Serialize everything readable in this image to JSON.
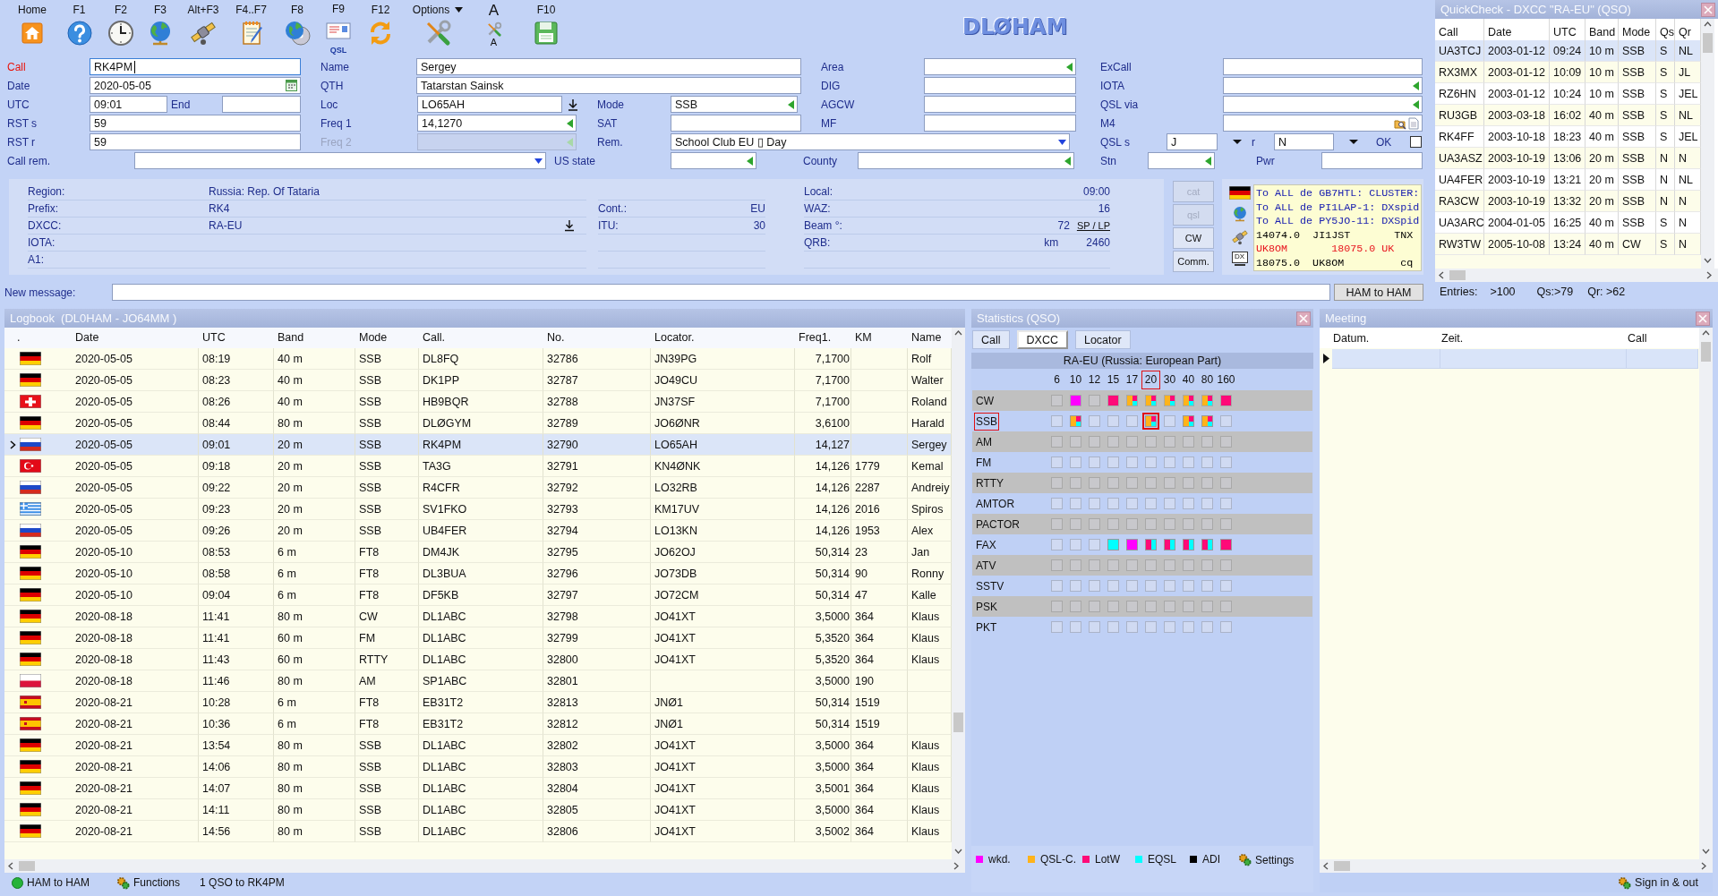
{
  "toolbar": {
    "buttons": [
      {
        "label": "Home"
      },
      {
        "label": "F1"
      },
      {
        "label": "F2"
      },
      {
        "label": "F3"
      },
      {
        "label": "Alt+F3"
      },
      {
        "label": "F4..F7"
      },
      {
        "label": "F8"
      },
      {
        "label": "F9",
        "caption": "QSL"
      },
      {
        "label": "F12"
      },
      {
        "label": "Options",
        "dropdown": true
      },
      {
        "label": "A",
        "caption": "A"
      },
      {
        "label": "F10"
      }
    ]
  },
  "logo": "DLØHAM",
  "form": {
    "fields": [
      {
        "label": "Call",
        "color": "#e8140c",
        "kind": "text",
        "value": "RK4PM",
        "focused": true
      },
      {
        "label": "Name",
        "kind": "text",
        "value": "Sergey"
      },
      {
        "label": "Area",
        "kind": "picker"
      },
      {
        "label": "ExCall",
        "kind": "text"
      },
      {
        "label": "Date",
        "kind": "date",
        "value": "2020-05-05"
      },
      {
        "label": "QTH",
        "kind": "text",
        "value": "Tatarstan Sainsk"
      },
      {
        "label": "DIG",
        "kind": "text"
      },
      {
        "label": "IOTA",
        "kind": "picker"
      },
      {
        "label": "UTC",
        "kind": "text",
        "value": "09:01"
      },
      {
        "label": "End",
        "kind": "text"
      },
      {
        "label": "Loc",
        "kind": "locator",
        "value": "LO65AH"
      },
      {
        "label": "Mode",
        "kind": "picker",
        "value": "SSB"
      },
      {
        "label": "AGCW",
        "kind": "text"
      },
      {
        "label": "QSL via",
        "kind": "picker"
      },
      {
        "label": "RST s",
        "kind": "text",
        "value": "59"
      },
      {
        "label": "Freq 1",
        "kind": "picker",
        "value": "14,1270"
      },
      {
        "label": "SAT",
        "kind": "text"
      },
      {
        "label": "MF",
        "kind": "text"
      },
      {
        "label": "M4",
        "kind": "memo"
      },
      {
        "label": "RST r",
        "kind": "text",
        "value": "59"
      },
      {
        "label": "Freq 2",
        "kind": "picker",
        "disabled": true
      },
      {
        "label": "Rem.",
        "kind": "combo",
        "value": "School Club EU ▯ Day"
      },
      {
        "label": "QSL s",
        "kind": "select",
        "value": "J"
      },
      {
        "label": "r",
        "kind": "select",
        "value": "N"
      },
      {
        "label": "OK",
        "kind": "checkbox",
        "checked": false
      },
      {
        "label": "Call rem.",
        "kind": "combo"
      },
      {
        "label": "US state",
        "kind": "picker"
      },
      {
        "label": "County",
        "kind": "picker"
      },
      {
        "label": "Stn",
        "kind": "picker"
      },
      {
        "label": "Pwr",
        "kind": "text"
      }
    ]
  },
  "info": {
    "rows": [
      [
        {
          "label": "Region:",
          "value": "Russia: Rep. Of Tataria"
        },
        null,
        {
          "label": "Local:",
          "value": "09:00"
        }
      ],
      [
        {
          "label": "Prefix:",
          "value": "RK4"
        },
        {
          "label": "Cont.:",
          "value": "EU"
        },
        {
          "label": "WAZ:",
          "value": "16"
        }
      ],
      [
        {
          "label": "DXCC:",
          "value": "RA-EU",
          "download": true
        },
        {
          "label": "ITU:",
          "value": "30"
        },
        {
          "label": "Beam °:",
          "value": "72",
          "link": "SP / LP"
        }
      ],
      [
        {
          "label": "IOTA:"
        },
        null,
        {
          "label": "QRB:",
          "unit": "km",
          "value": "2460"
        }
      ],
      [
        {
          "label": "A1:"
        }
      ]
    ],
    "buttons": [
      {
        "label": "cat",
        "disabled": true
      },
      {
        "label": "qsl",
        "disabled": true
      },
      {
        "label": "CW",
        "disabled": false
      },
      {
        "label": "Comm.",
        "disabled": false
      }
    ],
    "monitor_caption": "DX",
    "cluster": [
      {
        "text": "To ALL de GB7HTL: CLUSTER:",
        "color": "#1a20b0"
      },
      {
        "text": "To ALL de PI1LAP-1: DXspid",
        "color": "#1a20b0"
      },
      {
        "text": "To ALL de PY5JO-11: DXSpid",
        "color": "#1a20b0"
      },
      {
        "text": "14074.0  JI1JST       TNX",
        "color": "#000000"
      },
      {
        "text": "UK8OM       18075.0 UK",
        "color": "#e8141e"
      },
      {
        "text": "18075.0  UK8OM         cq",
        "color": "#000000"
      }
    ]
  },
  "message": {
    "label": "New message:",
    "button": "HAM to HAM"
  },
  "quickcheck": {
    "title": "QuickCheck - DXCC \"RA-EU\" (QSO)",
    "columns": [
      "Call",
      "Date",
      "UTC",
      "Band",
      "Mode",
      "Qs",
      "Qr"
    ],
    "rows": [
      {
        "cells": [
          "UA3TCJ",
          "2003-01-12",
          "09:24",
          "10 m",
          "SSB",
          "S",
          "NL"
        ],
        "selected": true
      },
      {
        "cells": [
          "RX3MX",
          "2003-01-12",
          "10:09",
          "10 m",
          "SSB",
          "S",
          "JL"
        ],
        "selected": false
      },
      {
        "cells": [
          "RZ6HN",
          "2003-01-12",
          "10:24",
          "10 m",
          "SSB",
          "S",
          "JEL"
        ],
        "selected": false
      },
      {
        "cells": [
          "RU3GB",
          "2003-03-18",
          "16:02",
          "40 m",
          "SSB",
          "S",
          "NL"
        ],
        "selected": false
      },
      {
        "cells": [
          "RK4FF",
          "2003-10-18",
          "18:23",
          "40 m",
          "SSB",
          "S",
          "JEL"
        ],
        "selected": false
      },
      {
        "cells": [
          "UA3ASZ",
          "2003-10-19",
          "13:06",
          "20 m",
          "SSB",
          "N",
          "N"
        ],
        "selected": false
      },
      {
        "cells": [
          "UA4FER",
          "2003-10-19",
          "13:21",
          "20 m",
          "SSB",
          "N",
          "NL"
        ],
        "selected": false
      },
      {
        "cells": [
          "RA3CW",
          "2003-10-19",
          "13:32",
          "20 m",
          "SSB",
          "N",
          "N"
        ],
        "selected": false
      },
      {
        "cells": [
          "UA3ARC",
          "2004-01-05",
          "16:25",
          "40 m",
          "SSB",
          "S",
          "N"
        ],
        "selected": false
      },
      {
        "cells": [
          "RW3TW",
          "2005-10-08",
          "13:24",
          "40 m",
          "CW",
          "S",
          "N"
        ],
        "selected": false
      }
    ],
    "summary": [
      "Entries:",
      ">100",
      "Qs:>79",
      "Qr: >62"
    ]
  },
  "logbook": {
    "title": "Logbook  (DL0HAM - JO64MM )",
    "columns": [
      ".",
      "Date",
      "UTC",
      "Band",
      "Mode",
      "Call.",
      "No.",
      "Locator.",
      "Freq1.",
      "KM",
      "Name"
    ],
    "rows": [
      {
        "date": "2020-05-05",
        "utc": "08:19",
        "band": "40 m",
        "mode": "SSB",
        "call": "DL8FQ",
        "no": "32786",
        "locator": "JN39PG",
        "freq": "7,1700",
        "name": "Rolf",
        "selected": false
      },
      {
        "date": "2020-05-05",
        "utc": "08:23",
        "band": "40 m",
        "mode": "SSB",
        "call": "DK1PP",
        "no": "32787",
        "locator": "JO49CU",
        "freq": "7,1700",
        "name": "Walter",
        "selected": false
      },
      {
        "date": "2020-05-05",
        "utc": "08:26",
        "band": "40 m",
        "mode": "SSB",
        "call": "HB9BQR",
        "no": "32788",
        "locator": "JN37SF",
        "freq": "7,1700",
        "name": "Roland",
        "selected": false
      },
      {
        "date": "2020-05-05",
        "utc": "08:44",
        "band": "80 m",
        "mode": "SSB",
        "call": "DLØGYM",
        "no": "32789",
        "locator": "JO6ØNR",
        "freq": "3,6100",
        "name": "Harald",
        "selected": false
      },
      {
        "date": "2020-05-05",
        "utc": "09:01",
        "band": "20 m",
        "mode": "SSB",
        "call": "RK4PM",
        "no": "32790",
        "locator": "LO65AH",
        "freq": "14,127",
        "name": "Sergey",
        "selected": true
      },
      {
        "date": "2020-05-05",
        "utc": "09:18",
        "band": "20 m",
        "mode": "SSB",
        "call": "TA3G",
        "no": "32791",
        "locator": "KN4ØNK",
        "freq": "14,126",
        "km": "1779",
        "name": "Kemal",
        "selected": false
      },
      {
        "date": "2020-05-05",
        "utc": "09:22",
        "band": "20 m",
        "mode": "SSB",
        "call": "R4CFR",
        "no": "32792",
        "locator": "LO32RB",
        "freq": "14,126",
        "km": "2287",
        "name": "Andreiy",
        "selected": false
      },
      {
        "date": "2020-05-05",
        "utc": "09:23",
        "band": "20 m",
        "mode": "SSB",
        "call": "SV1FKO",
        "no": "32793",
        "locator": "KM17UV",
        "freq": "14,126",
        "km": "2016",
        "name": "Spiros",
        "selected": false
      },
      {
        "date": "2020-05-05",
        "utc": "09:26",
        "band": "20 m",
        "mode": "SSB",
        "call": "UB4FER",
        "no": "32794",
        "locator": "LO13KN",
        "freq": "14,126",
        "km": "1953",
        "name": "Alex",
        "selected": false
      },
      {
        "date": "2020-05-10",
        "utc": "08:53",
        "band": "6 m",
        "mode": "FT8",
        "call": "DM4JK",
        "no": "32795",
        "locator": "JO62OJ",
        "freq": "50,314",
        "km": "23",
        "name": "Jan",
        "selected": false
      },
      {
        "date": "2020-05-10",
        "utc": "08:58",
        "band": "6 m",
        "mode": "FT8",
        "call": "DL3BUA",
        "no": "32796",
        "locator": "JO73DB",
        "freq": "50,314",
        "km": "90",
        "name": "Ronny",
        "selected": false
      },
      {
        "date": "2020-05-10",
        "utc": "09:04",
        "band": "6 m",
        "mode": "FT8",
        "call": "DF5KB",
        "no": "32797",
        "locator": "JO72CM",
        "freq": "50,314",
        "km": "47",
        "name": "Kalle",
        "selected": false
      },
      {
        "date": "2020-08-18",
        "utc": "11:41",
        "band": "80 m",
        "mode": "CW",
        "call": "DL1ABC",
        "no": "32798",
        "locator": "JO41XT",
        "freq": "3,5000",
        "km": "364",
        "name": "Klaus",
        "selected": false
      },
      {
        "date": "2020-08-18",
        "utc": "11:41",
        "band": "60 m",
        "mode": "FM",
        "call": "DL1ABC",
        "no": "32799",
        "locator": "JO41XT",
        "freq": "5,3520",
        "km": "364",
        "name": "Klaus",
        "selected": false
      },
      {
        "date": "2020-08-18",
        "utc": "11:43",
        "band": "60 m",
        "mode": "RTTY",
        "call": "DL1ABC",
        "no": "32800",
        "locator": "JO41XT",
        "freq": "5,3520",
        "km": "364",
        "name": "Klaus",
        "selected": false
      },
      {
        "date": "2020-08-18",
        "utc": "11:46",
        "band": "80 m",
        "mode": "AM",
        "call": "SP1ABC",
        "no": "32801",
        "freq": "3,5000",
        "km": "190",
        "selected": false
      },
      {
        "date": "2020-08-21",
        "utc": "10:28",
        "band": "6 m",
        "mode": "FT8",
        "call": "EB31T2",
        "no": "32813",
        "locator": "JNØ1",
        "freq": "50,314",
        "km": "1519",
        "selected": false
      },
      {
        "date": "2020-08-21",
        "utc": "10:36",
        "band": "6 m",
        "mode": "FT8",
        "call": "EB31T2",
        "no": "32812",
        "locator": "JNØ1",
        "freq": "50,314",
        "km": "1519",
        "selected": false
      },
      {
        "date": "2020-08-21",
        "utc": "13:54",
        "band": "80 m",
        "mode": "SSB",
        "call": "DL1ABC",
        "no": "32802",
        "locator": "JO41XT",
        "freq": "3,5000",
        "km": "364",
        "name": "Klaus",
        "selected": false
      },
      {
        "date": "2020-08-21",
        "utc": "14:06",
        "band": "80 m",
        "mode": "SSB",
        "call": "DL1ABC",
        "no": "32803",
        "locator": "JO41XT",
        "freq": "3,5000",
        "km": "364",
        "name": "Klaus",
        "selected": false
      },
      {
        "date": "2020-08-21",
        "utc": "14:07",
        "band": "80 m",
        "mode": "SSB",
        "call": "DL1ABC",
        "no": "32804",
        "locator": "JO41XT",
        "freq": "3,5001",
        "km": "364",
        "name": "Klaus",
        "selected": false
      },
      {
        "date": "2020-08-21",
        "utc": "14:11",
        "band": "80 m",
        "mode": "SSB",
        "call": "DL1ABC",
        "no": "32805",
        "locator": "JO41XT",
        "freq": "3,5000",
        "km": "364",
        "name": "Klaus",
        "selected": false
      },
      {
        "date": "2020-08-21",
        "utc": "14:56",
        "band": "80 m",
        "mode": "SSB",
        "call": "DL1ABC",
        "no": "32806",
        "locator": "JO41XT",
        "freq": "3,5002",
        "km": "364",
        "name": "Klaus",
        "selected": false
      }
    ],
    "status": [
      "HAM to HAM",
      "Functions",
      "1 QSO to RK4PM"
    ]
  },
  "statistics": {
    "title": "Statistics (QSO)",
    "tabs": [
      {
        "label": "Call",
        "selected": false
      },
      {
        "label": "DXCC",
        "selected": true
      },
      {
        "label": "Locator",
        "selected": false
      }
    ],
    "heading": "RA-EU (Russia: European Part)",
    "bands": [
      {
        "label": "6",
        "selected": false
      },
      {
        "label": "10",
        "selected": false
      },
      {
        "label": "12",
        "selected": false
      },
      {
        "label": "15",
        "selected": false
      },
      {
        "label": "17",
        "selected": false
      },
      {
        "label": "20",
        "selected": true
      },
      {
        "label": "30",
        "selected": false
      },
      {
        "label": "40",
        "selected": false
      },
      {
        "label": "80",
        "selected": false
      },
      {
        "label": "160",
        "selected": false
      }
    ],
    "modes": [
      {
        "label": "CW",
        "selected": false,
        "wkd": [
          false,
          true,
          false,
          false,
          false,
          false,
          false,
          false,
          false,
          false
        ],
        "qsl_c": [
          false,
          false,
          false,
          false,
          true,
          true,
          true,
          true,
          true,
          false
        ],
        "lotw": [
          false,
          false,
          false,
          true,
          true,
          true,
          true,
          true,
          true,
          true
        ],
        "eqsl": [
          false,
          false,
          false,
          false,
          true,
          true,
          true,
          true,
          true,
          false
        ]
      },
      {
        "label": "SSB",
        "selected": true,
        "wkd": [
          false,
          false,
          false,
          false,
          false,
          false,
          false,
          false,
          false,
          false
        ],
        "qsl_c": [
          false,
          true,
          false,
          false,
          false,
          true,
          false,
          true,
          true,
          false
        ],
        "lotw": [
          false,
          true,
          false,
          false,
          false,
          true,
          false,
          true,
          true,
          false
        ],
        "eqsl": [
          false,
          true,
          false,
          false,
          false,
          true,
          false,
          true,
          true,
          false
        ]
      },
      {
        "label": "AM",
        "selected": false,
        "wkd": [
          false,
          false,
          false,
          false,
          false,
          false,
          false,
          false,
          false,
          false
        ],
        "qsl_c": [
          false,
          false,
          false,
          false,
          false,
          false,
          false,
          false,
          false,
          false
        ],
        "lotw": [
          false,
          false,
          false,
          false,
          false,
          false,
          false,
          false,
          false,
          false
        ],
        "eqsl": [
          false,
          false,
          false,
          false,
          false,
          false,
          false,
          false,
          false,
          false
        ]
      },
      {
        "label": "FM",
        "selected": false,
        "wkd": [
          false,
          false,
          false,
          false,
          false,
          false,
          false,
          false,
          false,
          false
        ],
        "qsl_c": [
          false,
          false,
          false,
          false,
          false,
          false,
          false,
          false,
          false,
          false
        ],
        "lotw": [
          false,
          false,
          false,
          false,
          false,
          false,
          false,
          false,
          false,
          false
        ],
        "eqsl": [
          false,
          false,
          false,
          false,
          false,
          false,
          false,
          false,
          false,
          false
        ]
      },
      {
        "label": "RTTY",
        "selected": false,
        "wkd": [
          false,
          false,
          false,
          false,
          false,
          false,
          false,
          false,
          false,
          false
        ],
        "qsl_c": [
          false,
          false,
          false,
          false,
          false,
          false,
          false,
          false,
          false,
          false
        ],
        "lotw": [
          false,
          false,
          false,
          false,
          false,
          false,
          false,
          false,
          false,
          false
        ],
        "eqsl": [
          false,
          false,
          false,
          false,
          false,
          false,
          false,
          false,
          false,
          false
        ]
      },
      {
        "label": "AMTOR",
        "selected": false,
        "wkd": [
          false,
          false,
          false,
          false,
          false,
          false,
          false,
          false,
          false,
          false
        ],
        "qsl_c": [
          false,
          false,
          false,
          false,
          false,
          false,
          false,
          false,
          false,
          false
        ],
        "lotw": [
          false,
          false,
          false,
          false,
          false,
          false,
          false,
          false,
          false,
          false
        ],
        "eqsl": [
          false,
          false,
          false,
          false,
          false,
          false,
          false,
          false,
          false,
          false
        ]
      },
      {
        "label": "PACTOR",
        "selected": false,
        "wkd": [
          false,
          false,
          false,
          false,
          false,
          false,
          false,
          false,
          false,
          false
        ],
        "qsl_c": [
          false,
          false,
          false,
          false,
          false,
          false,
          false,
          false,
          false,
          false
        ],
        "lotw": [
          false,
          false,
          false,
          false,
          false,
          false,
          false,
          false,
          false,
          false
        ],
        "eqsl": [
          false,
          false,
          false,
          false,
          false,
          false,
          false,
          false,
          false,
          false
        ]
      },
      {
        "label": "FAX",
        "selected": false,
        "wkd": [
          false,
          false,
          false,
          false,
          true,
          false,
          false,
          false,
          false,
          false
        ],
        "qsl_c": [
          false,
          false,
          false,
          false,
          false,
          false,
          false,
          false,
          false,
          false
        ],
        "lotw": [
          false,
          false,
          false,
          false,
          false,
          true,
          true,
          true,
          true,
          true
        ],
        "eqsl": [
          false,
          false,
          false,
          true,
          false,
          true,
          true,
          true,
          true,
          false
        ]
      },
      {
        "label": "ATV",
        "selected": false,
        "wkd": [
          false,
          false,
          false,
          false,
          false,
          false,
          false,
          false,
          false,
          false
        ],
        "qsl_c": [
          false,
          false,
          false,
          false,
          false,
          false,
          false,
          false,
          false,
          false
        ],
        "lotw": [
          false,
          false,
          false,
          false,
          false,
          false,
          false,
          false,
          false,
          false
        ],
        "eqsl": [
          false,
          false,
          false,
          false,
          false,
          false,
          false,
          false,
          false,
          false
        ]
      },
      {
        "label": "SSTV",
        "selected": false,
        "wkd": [
          false,
          false,
          false,
          false,
          false,
          false,
          false,
          false,
          false,
          false
        ],
        "qsl_c": [
          false,
          false,
          false,
          false,
          false,
          false,
          false,
          false,
          false,
          false
        ],
        "lotw": [
          false,
          false,
          false,
          false,
          false,
          false,
          false,
          false,
          false,
          false
        ],
        "eqsl": [
          false,
          false,
          false,
          false,
          false,
          false,
          false,
          false,
          false,
          false
        ]
      },
      {
        "label": "PSK",
        "selected": false,
        "wkd": [
          false,
          false,
          false,
          false,
          false,
          false,
          false,
          false,
          false,
          false
        ],
        "qsl_c": [
          false,
          false,
          false,
          false,
          false,
          false,
          false,
          false,
          false,
          false
        ],
        "lotw": [
          false,
          false,
          false,
          false,
          false,
          false,
          false,
          false,
          false,
          false
        ],
        "eqsl": [
          false,
          false,
          false,
          false,
          false,
          false,
          false,
          false,
          false,
          false
        ]
      },
      {
        "label": "PKT",
        "selected": false,
        "wkd": [
          false,
          false,
          false,
          false,
          false,
          false,
          false,
          false,
          false,
          false
        ],
        "qsl_c": [
          false,
          false,
          false,
          false,
          false,
          false,
          false,
          false,
          false,
          false
        ],
        "lotw": [
          false,
          false,
          false,
          false,
          false,
          false,
          false,
          false,
          false,
          false
        ],
        "eqsl": [
          false,
          false,
          false,
          false,
          false,
          false,
          false,
          false,
          false,
          false
        ]
      }
    ],
    "legend": [
      {
        "label": "wkd.",
        "color": "#ff00ff"
      },
      {
        "label": "QSL-C.",
        "color": "#ffb31a"
      },
      {
        "label": "LotW",
        "color": "#ff0a78"
      },
      {
        "label": "EQSL",
        "color": "#00ffff"
      },
      {
        "label": "ADI",
        "color": "#000000"
      }
    ],
    "settings": "Settings"
  },
  "meeting": {
    "title": "Meeting",
    "columns": [
      "Datum.",
      "Zeit.",
      "Call"
    ],
    "status": "Sign in & out"
  }
}
